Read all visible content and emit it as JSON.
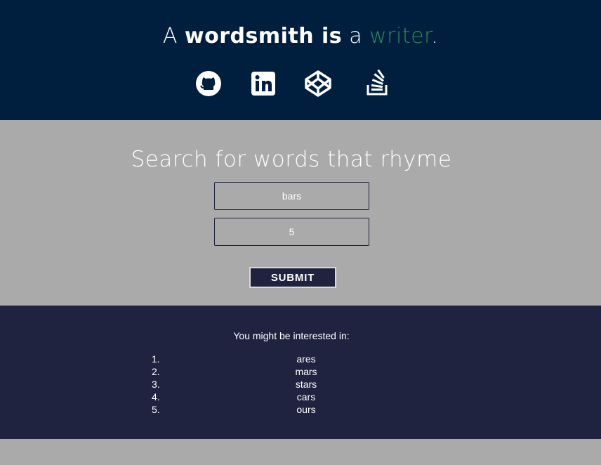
{
  "header": {
    "tagline": {
      "part1": "A ",
      "bold": "wordsmith is",
      "part2": " a ",
      "accent": "writer",
      "end": "."
    },
    "social": [
      {
        "icon": "github-icon"
      },
      {
        "icon": "linkedin-icon"
      },
      {
        "icon": "codepen-icon"
      },
      {
        "icon": "stackoverflow-icon"
      }
    ]
  },
  "search": {
    "title": "Search for words that rhyme",
    "word_value": "bars",
    "count_value": "5",
    "submit_label": "SUBMIT"
  },
  "results": {
    "heading": "You might be interested in:",
    "items": [
      {
        "num": "1.",
        "word": "ares"
      },
      {
        "num": "2.",
        "word": "mars"
      },
      {
        "num": "3.",
        "word": "stars"
      },
      {
        "num": "4.",
        "word": "cars"
      },
      {
        "num": "5.",
        "word": "ours"
      }
    ]
  },
  "colors": {
    "header_bg": "#001f3f",
    "search_bg": "#aaaaaa",
    "results_bg": "#1f2340",
    "accent": "#2e8b57"
  }
}
